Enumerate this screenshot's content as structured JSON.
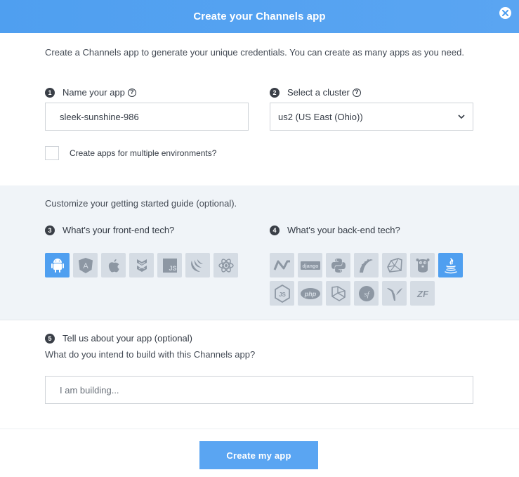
{
  "header": {
    "title": "Create your Channels app"
  },
  "intro": "Create a Channels app to generate your unique credentials. You can create as many apps as you need.",
  "step1": {
    "number": "1",
    "label": "Name your app",
    "help": "?",
    "value": "sleek-sunshine-986"
  },
  "step2": {
    "number": "2",
    "label": "Select a cluster",
    "help": "?",
    "selected": "us2 (US East (Ohio))"
  },
  "multi_env": {
    "label": "Create apps for multiple environments?",
    "checked": false
  },
  "customize": "Customize your getting started guide (optional).",
  "step3": {
    "number": "3",
    "label": "What's your front-end tech?",
    "techs": [
      {
        "name": "Android",
        "icon": "android-icon",
        "active": true
      },
      {
        "name": "Angular",
        "icon": "angular-icon",
        "active": false,
        "glyph": "A"
      },
      {
        "name": "iOS",
        "icon": "apple-icon",
        "active": false
      },
      {
        "name": "Backbone",
        "icon": "backbone-icon",
        "active": false
      },
      {
        "name": "JavaScript",
        "icon": "js-icon",
        "active": false,
        "glyph": "JS"
      },
      {
        "name": "jQuery",
        "icon": "jquery-icon",
        "active": false
      },
      {
        "name": "React",
        "icon": "react-icon",
        "active": false
      }
    ]
  },
  "step4": {
    "number": "4",
    "label": "What's your back-end tech?",
    "techs": [
      {
        "name": ".NET",
        "icon": "dotnet-icon",
        "active": false
      },
      {
        "name": "Django",
        "icon": "django-icon",
        "active": false,
        "glyph": "django"
      },
      {
        "name": "Python",
        "icon": "python-icon",
        "active": false
      },
      {
        "name": "Rails",
        "icon": "rails-icon",
        "active": false
      },
      {
        "name": "Ruby",
        "icon": "ruby-icon",
        "active": false
      },
      {
        "name": "Go",
        "icon": "gopher-icon",
        "active": false
      },
      {
        "name": "Java",
        "icon": "java-icon",
        "active": true
      },
      {
        "name": "Node.js",
        "icon": "nodejs-icon",
        "active": false,
        "glyph": "JS"
      },
      {
        "name": "PHP",
        "icon": "php-icon",
        "active": false,
        "glyph": "php"
      },
      {
        "name": "Laravel",
        "icon": "laravel-icon",
        "active": false
      },
      {
        "name": "Symfony",
        "icon": "symfony-icon",
        "active": false,
        "glyph": "sf"
      },
      {
        "name": "Yii",
        "icon": "yii-icon",
        "active": false
      },
      {
        "name": "Zend",
        "icon": "zend-icon",
        "active": false,
        "glyph": "ZF"
      }
    ]
  },
  "step5": {
    "number": "5",
    "label": "Tell us about your app (optional)",
    "question": "What do you intend to build with this Channels app?",
    "placeholder": "I am building..."
  },
  "submit_label": "Create my app",
  "colors": {
    "accent": "#5aa5f2",
    "tile_inactive": "#d5dce4",
    "section_bg": "#f0f4f8"
  }
}
